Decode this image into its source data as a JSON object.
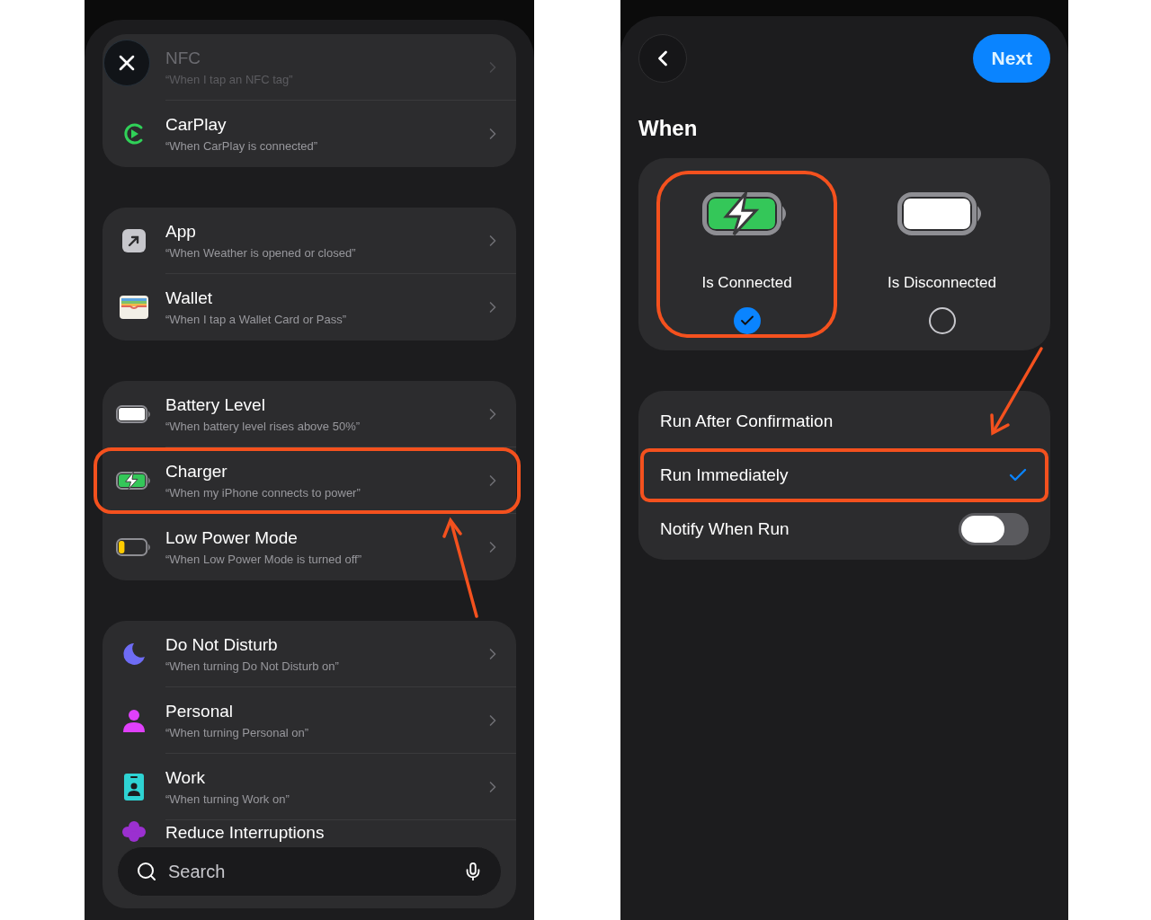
{
  "left_screen": {
    "groups": [
      {
        "items": [
          {
            "title": "NFC",
            "subtitle": "“When I tap an NFC tag”",
            "disabled": true,
            "highlighted": false
          },
          {
            "title": "CarPlay",
            "subtitle": "“When CarPlay is connected”",
            "disabled": false,
            "highlighted": false
          }
        ]
      },
      {
        "items": [
          {
            "title": "App",
            "subtitle": "“When Weather is opened or closed”",
            "disabled": false,
            "highlighted": false
          },
          {
            "title": "Wallet",
            "subtitle": "“When I tap a Wallet Card or Pass”",
            "disabled": false,
            "highlighted": false
          }
        ]
      },
      {
        "items": [
          {
            "title": "Battery Level",
            "subtitle": "“When battery level rises above 50%”",
            "disabled": false,
            "highlighted": false
          },
          {
            "title": "Charger",
            "subtitle": "“When my iPhone connects to power”",
            "disabled": false,
            "highlighted": true
          },
          {
            "title": "Low Power Mode",
            "subtitle": "“When Low Power Mode is turned off”",
            "disabled": false,
            "highlighted": false
          }
        ]
      },
      {
        "items": [
          {
            "title": "Do Not Disturb",
            "subtitle": "“When turning Do Not Disturb on”",
            "disabled": false,
            "highlighted": false
          },
          {
            "title": "Personal",
            "subtitle": "“When turning Personal on”",
            "disabled": false,
            "highlighted": false
          },
          {
            "title": "Work",
            "subtitle": "“When turning Work on”",
            "disabled": false,
            "highlighted": false
          },
          {
            "title": "Reduce Interruptions",
            "disabled": false,
            "highlighted": false
          }
        ]
      }
    ],
    "search": {
      "placeholder": "Search"
    }
  },
  "right_screen": {
    "next_button": "Next",
    "title": "When",
    "options": [
      {
        "label": "Is Connected",
        "selected": true,
        "highlighted": true
      },
      {
        "label": "Is Disconnected",
        "selected": false,
        "highlighted": false
      }
    ],
    "run_modes": [
      {
        "kind": "choice",
        "label": "Run After Confirmation",
        "selected": false,
        "highlighted": false
      },
      {
        "kind": "choice",
        "label": "Run Immediately",
        "selected": true,
        "highlighted": true
      },
      {
        "kind": "toggle",
        "label": "Notify When Run",
        "on": false,
        "highlighted": false
      }
    ]
  }
}
